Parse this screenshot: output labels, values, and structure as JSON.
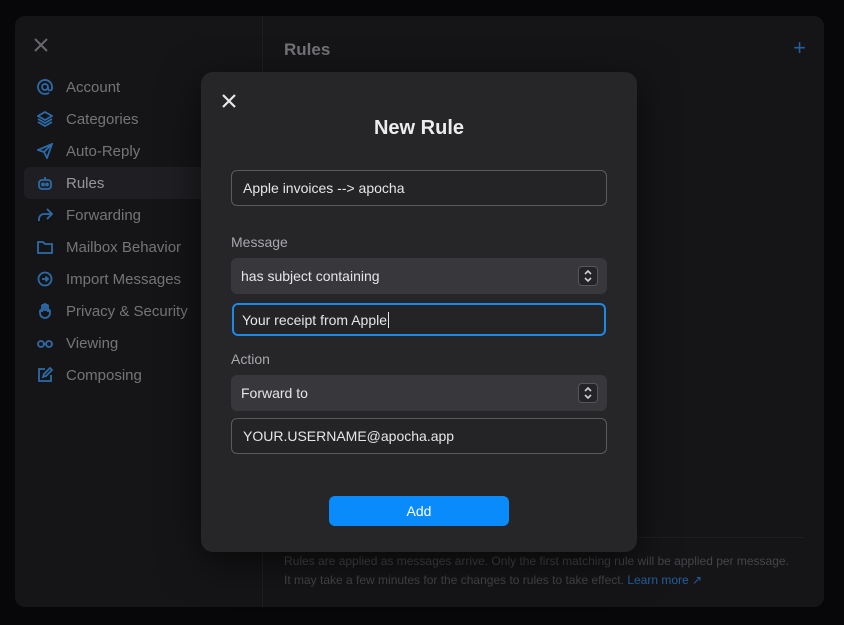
{
  "sidebar": {
    "items": [
      {
        "label": "Account",
        "icon": "at-sign-icon"
      },
      {
        "label": "Categories",
        "icon": "layers-icon"
      },
      {
        "label": "Auto-Reply",
        "icon": "paper-plane-icon"
      },
      {
        "label": "Rules",
        "icon": "robot-icon",
        "active": true
      },
      {
        "label": "Forwarding",
        "icon": "forward-arrow-icon"
      },
      {
        "label": "Mailbox Behavior",
        "icon": "folder-icon"
      },
      {
        "label": "Import Messages",
        "icon": "import-icon"
      },
      {
        "label": "Privacy & Security",
        "icon": "hand-icon"
      },
      {
        "label": "Viewing",
        "icon": "glasses-icon"
      },
      {
        "label": "Composing",
        "icon": "compose-icon"
      }
    ]
  },
  "main": {
    "title": "Rules",
    "footer_note": "Rules are applied as messages arrive. Only the first matching rule will be applied per message. It may take a few minutes for the changes to rules to take effect.",
    "learn_more": "Learn more ↗"
  },
  "modal": {
    "title": "New Rule",
    "rule_name_value": "Apple invoices --> apocha",
    "message_label": "Message",
    "message_condition": "has subject containing",
    "message_value": "Your receipt from Apple",
    "action_label": "Action",
    "action_selected": "Forward to",
    "action_value": "YOUR.USERNAME@apocha.app",
    "add_label": "Add"
  },
  "colors": {
    "accent": "#0a8bfb",
    "icon_blue": "#3b8ee0",
    "modal_bg": "#262629",
    "window_bg": "#1c1c1f"
  }
}
